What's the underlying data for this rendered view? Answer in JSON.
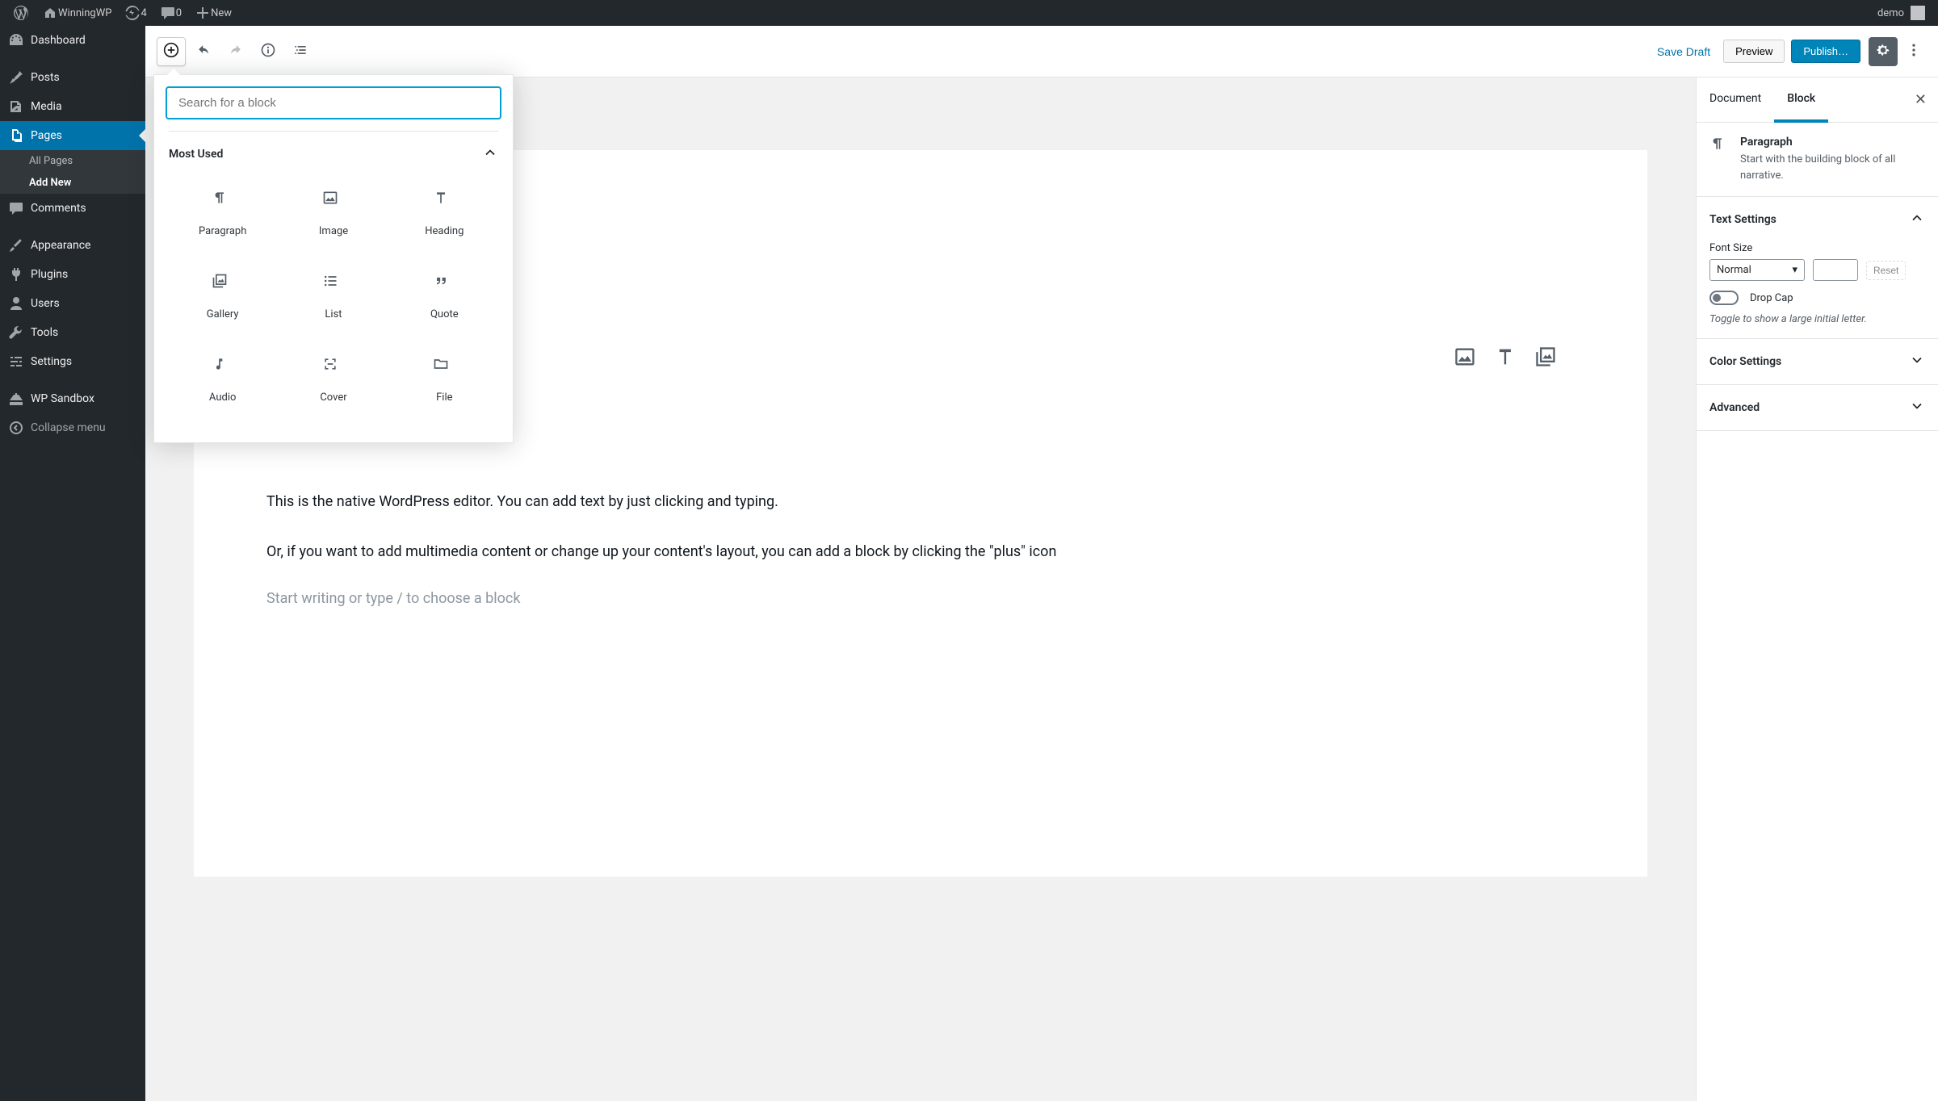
{
  "adminbar": {
    "site_name": "WinningWP",
    "updates_count": "4",
    "comments_count": "0",
    "new_label": "New",
    "user_name": "demo"
  },
  "sidebar": {
    "items": [
      {
        "key": "dashboard",
        "label": "Dashboard"
      },
      {
        "key": "posts",
        "label": "Posts"
      },
      {
        "key": "media",
        "label": "Media"
      },
      {
        "key": "pages",
        "label": "Pages",
        "current": true,
        "sub": [
          {
            "label": "All Pages",
            "current": false
          },
          {
            "label": "Add New",
            "current": true
          }
        ]
      },
      {
        "key": "comments",
        "label": "Comments"
      },
      {
        "key": "appearance",
        "label": "Appearance"
      },
      {
        "key": "plugins",
        "label": "Plugins"
      },
      {
        "key": "users",
        "label": "Users"
      },
      {
        "key": "tools",
        "label": "Tools"
      },
      {
        "key": "settings",
        "label": "Settings"
      },
      {
        "key": "sandbox",
        "label": "WP Sandbox"
      }
    ],
    "collapse_label": "Collapse menu"
  },
  "header": {
    "save_draft": "Save Draft",
    "preview": "Preview",
    "publish": "Publish…"
  },
  "inserter": {
    "search_placeholder": "Search for a block",
    "section_most_used": "Most Used",
    "blocks": [
      {
        "name": "paragraph",
        "label": "Paragraph"
      },
      {
        "name": "image",
        "label": "Image"
      },
      {
        "name": "heading",
        "label": "Heading"
      },
      {
        "name": "gallery",
        "label": "Gallery"
      },
      {
        "name": "list",
        "label": "List"
      },
      {
        "name": "quote",
        "label": "Quote"
      },
      {
        "name": "audio",
        "label": "Audio"
      },
      {
        "name": "cover",
        "label": "Cover"
      },
      {
        "name": "file",
        "label": "File"
      }
    ]
  },
  "content": {
    "p1": "This is the native WordPress editor. You can add text by just clicking and typing.",
    "p2": "Or, if you want to add multimedia content or change up your content's layout, you can add a block by clicking the \"plus\" icon",
    "placeholder": "Start writing or type / to choose a block"
  },
  "inspector": {
    "tab_document": "Document",
    "tab_block": "Block",
    "block_title": "Paragraph",
    "block_desc": "Start with the building block of all narrative.",
    "panel_text_settings": "Text Settings",
    "font_size_label": "Font Size",
    "font_size_value": "Normal",
    "reset_label": "Reset",
    "dropcap_label": "Drop Cap",
    "dropcap_hint": "Toggle to show a large initial letter.",
    "panel_color_settings": "Color Settings",
    "panel_advanced": "Advanced"
  }
}
